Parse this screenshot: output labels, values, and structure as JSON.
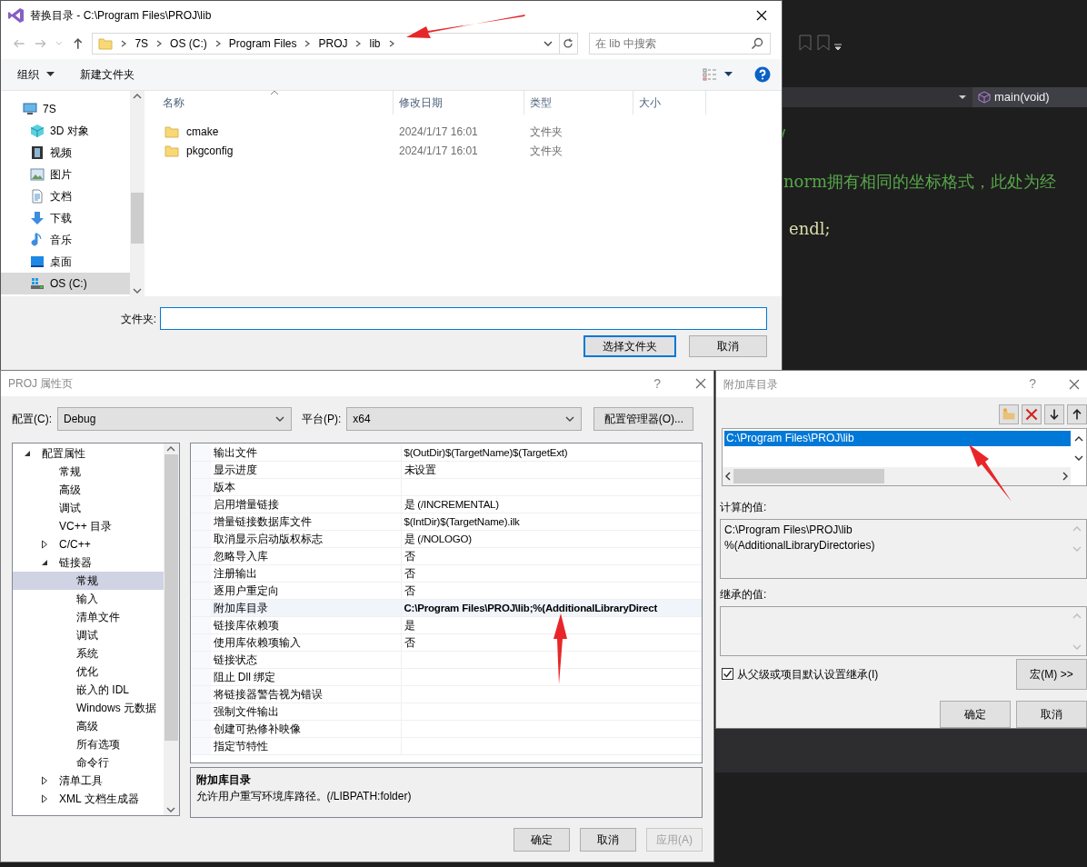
{
  "editor": {
    "member_dropdown": "main(void)",
    "code_lines": [
      {
        "kind": "comment",
        "text": "/"
      },
      {
        "kind": "comment",
        "text": "norm拥有相同的坐标格式，此处为经"
      },
      {
        "kind": "code",
        "text": "endl;"
      }
    ]
  },
  "folder_dialog": {
    "title": "替换目录 - C:\\Program Files\\PROJ\\lib",
    "breadcrumbs": [
      "7S",
      "OS (C:)",
      "Program Files",
      "PROJ",
      "lib"
    ],
    "search": {
      "placeholder": "在 lib 中搜索"
    },
    "toolbar": [
      {
        "label": "组织",
        "dropdown": true
      },
      {
        "label": "新建文件夹",
        "dropdown": false
      }
    ],
    "nav_items": [
      {
        "label": "7S",
        "kind": "computer",
        "selected": false
      },
      {
        "label": "3D 对象",
        "kind": "cube",
        "selected": false
      },
      {
        "label": "视频",
        "kind": "film",
        "selected": false
      },
      {
        "label": "图片",
        "kind": "image",
        "selected": false
      },
      {
        "label": "文档",
        "kind": "document",
        "selected": false
      },
      {
        "label": "下载",
        "kind": "download",
        "selected": false
      },
      {
        "label": "音乐",
        "kind": "music",
        "selected": false
      },
      {
        "label": "桌面",
        "kind": "desktop",
        "selected": false
      },
      {
        "label": "OS (C:)",
        "kind": "drive",
        "selected": true
      }
    ],
    "columns": [
      "名称",
      "修改日期",
      "类型",
      "大小"
    ],
    "files": [
      {
        "name": "cmake",
        "modified": "2024/1/17 16:01",
        "type": "文件夹"
      },
      {
        "name": "pkgconfig",
        "modified": "2024/1/17 16:01",
        "type": "文件夹"
      }
    ],
    "folder_field": {
      "label": "文件夹:"
    },
    "buttons": [
      {
        "label": "选择文件夹",
        "default": true
      },
      {
        "label": "取消",
        "default": false
      }
    ]
  },
  "property_pages": {
    "title": "PROJ 属性页",
    "help": "?",
    "configuration": {
      "label": "配置(C):",
      "value": "Debug"
    },
    "platform": {
      "label": "平台(P):",
      "value": "x64"
    },
    "config_manager": "配置管理器(O)...",
    "tree": [
      {
        "label": "配置属性",
        "selected": false,
        "expanded": true,
        "children": [
          {
            "label": "常规",
            "selected": false
          },
          {
            "label": "高级",
            "selected": false
          },
          {
            "label": "调试",
            "selected": false
          },
          {
            "label": "VC++ 目录",
            "selected": false
          },
          {
            "label": "C/C++",
            "selected": false,
            "expanded": false
          },
          {
            "label": "链接器",
            "selected": false,
            "expanded": true,
            "children": [
              {
                "label": "常规",
                "selected": true
              },
              {
                "label": "输入",
                "selected": false
              },
              {
                "label": "清单文件",
                "selected": false
              },
              {
                "label": "调试",
                "selected": false
              },
              {
                "label": "系统",
                "selected": false
              },
              {
                "label": "优化",
                "selected": false
              },
              {
                "label": "嵌入的 IDL",
                "selected": false
              },
              {
                "label": "Windows 元数据",
                "selected": false
              },
              {
                "label": "高级",
                "selected": false
              },
              {
                "label": "所有选项",
                "selected": false
              },
              {
                "label": "命令行",
                "selected": false
              }
            ]
          },
          {
            "label": "清单工具",
            "selected": false,
            "expanded": false
          },
          {
            "label": "XML 文档生成器",
            "selected": false,
            "expanded": false
          }
        ]
      }
    ],
    "properties": [
      {
        "name": "输出文件",
        "value": "$(OutDir)$(TargetName)$(TargetExt)",
        "selected": false,
        "modified": false
      },
      {
        "name": "显示进度",
        "value": "未设置",
        "selected": false,
        "modified": false
      },
      {
        "name": "版本",
        "selected": false
      },
      {
        "name": "启用增量链接",
        "value": "是 (/INCREMENTAL)",
        "selected": false,
        "modified": false
      },
      {
        "name": "增量链接数据库文件",
        "value": "$(IntDir)$(TargetName).ilk",
        "selected": false,
        "modified": false
      },
      {
        "name": "取消显示启动版权标志",
        "value": "是 (/NOLOGO)",
        "selected": false,
        "modified": false
      },
      {
        "name": "忽略导入库",
        "value": "否",
        "selected": false,
        "modified": false
      },
      {
        "name": "注册输出",
        "value": "否",
        "selected": false,
        "modified": false
      },
      {
        "name": "逐用户重定向",
        "value": "否",
        "selected": false,
        "modified": false
      },
      {
        "name": "附加库目录",
        "value": "C:\\Program Files\\PROJ\\lib;%(AdditionalLibraryDirect",
        "selected": true,
        "modified": true
      },
      {
        "name": "链接库依赖项",
        "value": "是",
        "selected": false,
        "modified": false
      },
      {
        "name": "使用库依赖项输入",
        "value": "否",
        "selected": false,
        "modified": false
      },
      {
        "name": "链接状态",
        "selected": false
      },
      {
        "name": "阻止 Dll 绑定",
        "selected": false
      },
      {
        "name": "将链接器警告视为错误",
        "selected": false
      },
      {
        "name": "强制文件输出",
        "selected": false
      },
      {
        "name": "创建可热修补映像",
        "selected": false
      },
      {
        "name": "指定节特性",
        "selected": false
      }
    ],
    "description": {
      "title": "附加库目录",
      "text": "允许用户重写环境库路径。(/LIBPATH:folder)"
    },
    "buttons": [
      {
        "label": "确定",
        "disabled": false
      },
      {
        "label": "取消",
        "disabled": false
      },
      {
        "label": "应用(A)",
        "disabled": true
      }
    ]
  },
  "library_dialog": {
    "title": "附加库目录",
    "help": "?",
    "directories": [
      {
        "path": "C:\\Program Files\\PROJ\\lib",
        "selected": true
      }
    ],
    "computed_label": "计算的值:",
    "computed_lines": [
      "C:\\Program Files\\PROJ\\lib",
      "%(AdditionalLibraryDirectories)"
    ],
    "inherited_label": "继承的值:",
    "inherit": {
      "label": "从父级或项目默认设置继承(I)",
      "checked": true
    },
    "macros_button": "宏(M) >>",
    "buttons": [
      "确定",
      "取消"
    ]
  }
}
